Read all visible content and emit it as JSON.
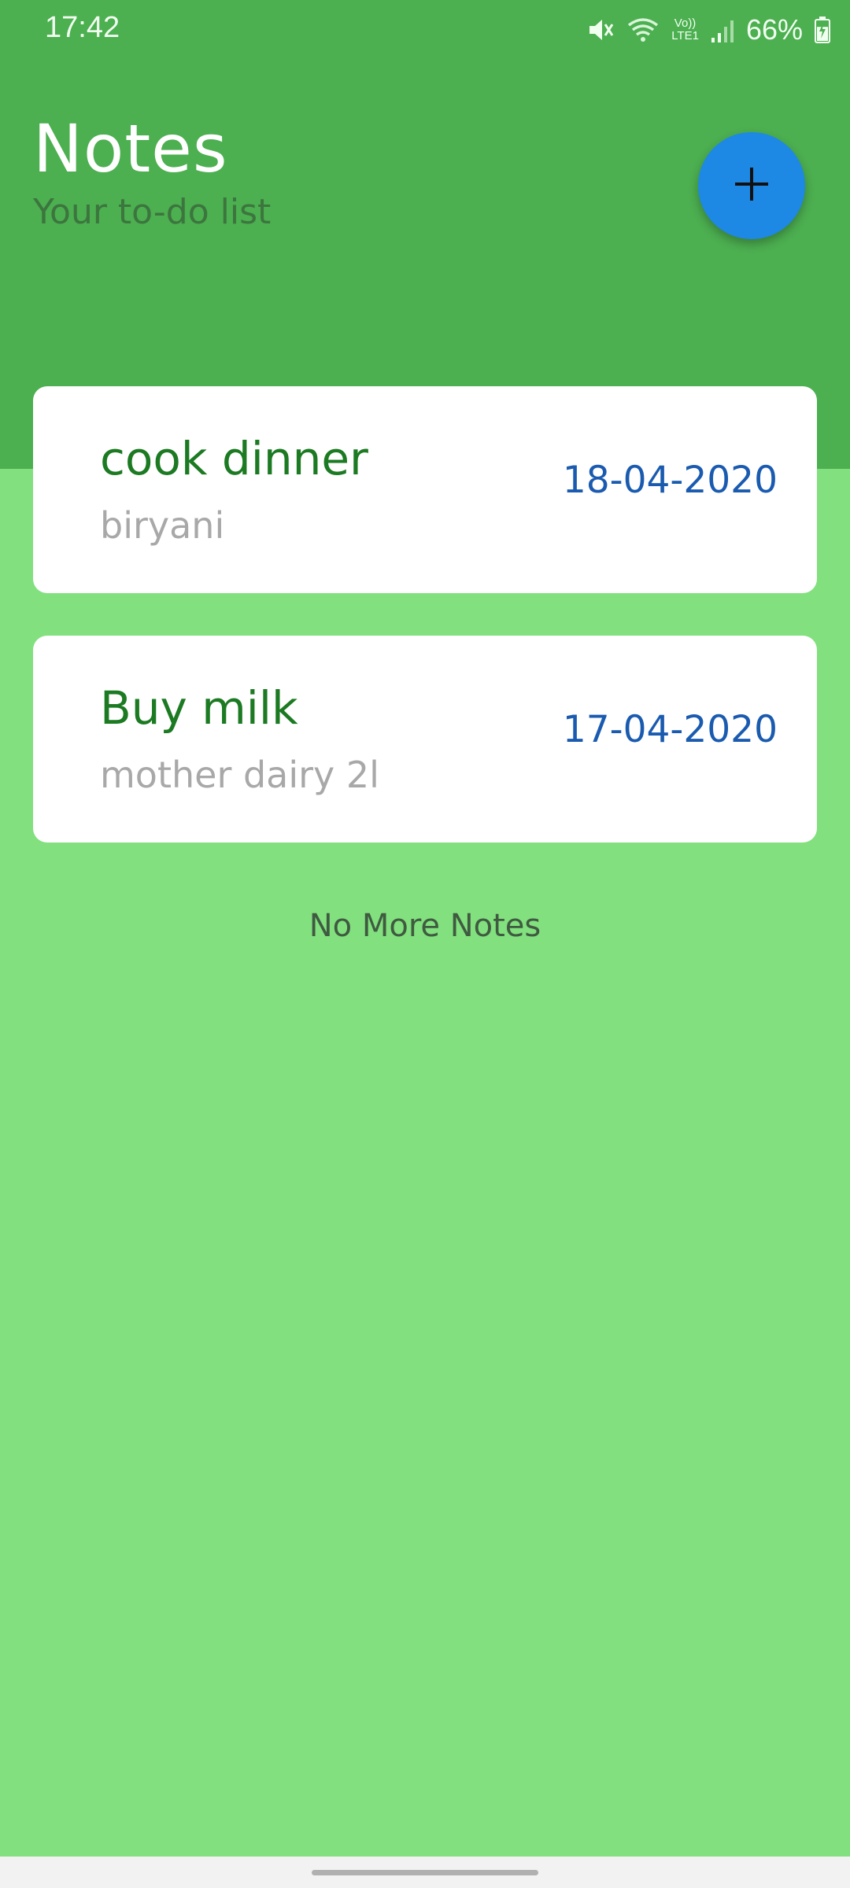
{
  "status_bar": {
    "time": "17:42",
    "volte_label": "Vo))",
    "lte_label": "LTE1",
    "battery_percent": "66%",
    "battery_level": 0.66,
    "icons": [
      "mute-icon",
      "wifi-icon",
      "signal-icon",
      "battery-charging-icon"
    ]
  },
  "header": {
    "title": "Notes",
    "subtitle": "Your to-do list",
    "background_color": "#4caf50"
  },
  "fab": {
    "icon": "plus-icon",
    "color": "#1e88e5"
  },
  "notes": [
    {
      "title": "cook dinner",
      "description": "biryani",
      "date": "18-04-2020"
    },
    {
      "title": "Buy milk",
      "description": "mother dairy 2l",
      "date": "17-04-2020"
    }
  ],
  "list_footer": "No More Notes",
  "colors": {
    "page_background": "#82e07f",
    "title_green": "#1b7a22",
    "date_blue": "#1a5bb0",
    "description_gray": "#a8a8a8"
  }
}
